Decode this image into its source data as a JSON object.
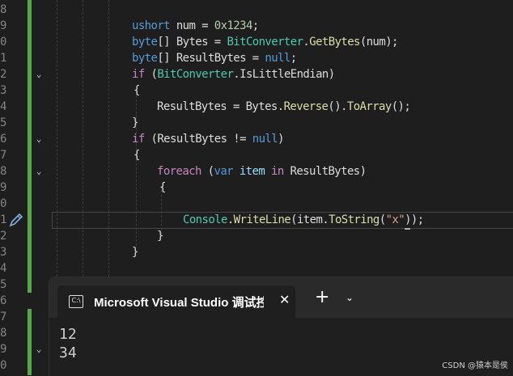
{
  "editor": {
    "line_numbers": [
      "8",
      "9",
      "0",
      "1",
      "2",
      "3",
      "4",
      "5",
      "6",
      "7",
      "8",
      "9",
      "0",
      "1",
      "2",
      "3",
      "4",
      "5",
      "6",
      "7",
      "8",
      "9",
      "0"
    ],
    "code": {
      "l1": {
        "t1": "ushort",
        "t2": " num = ",
        "t3": "0x1234",
        "t4": ";"
      },
      "l2": {
        "t1": "byte",
        "t2": "[] Bytes = ",
        "t3": "BitConverter",
        "t4": ".",
        "t5": "GetBytes",
        "t6": "(num);"
      },
      "l3": {
        "t1": "byte",
        "t2": "[] ResultBytes = ",
        "t3": "null",
        "t4": ";"
      },
      "l4": {
        "t1": "if",
        "t2": " (",
        "t3": "BitConverter",
        "t4": ".",
        "t5": "IsLittleEndian",
        "t6": ")"
      },
      "l5": {
        "t1": "{"
      },
      "l6": {
        "t1": "ResultBytes = Bytes.",
        "t2": "Reverse",
        "t3": "().",
        "t4": "ToArray",
        "t5": "();"
      },
      "l7": {
        "t1": "}"
      },
      "l8": {
        "t1": "if",
        "t2": " (ResultBytes != ",
        "t3": "null",
        "t4": ")"
      },
      "l9": {
        "t1": "{"
      },
      "l10": {
        "t1": "foreach",
        "t2": " (",
        "t3": "var",
        "t4": " ",
        "t5": "item",
        "t6": " ",
        "t7": "in",
        "t8": " ResultBytes)"
      },
      "l11": {
        "t1": "{"
      },
      "l12": {
        "t1": "Console",
        "t2": ".",
        "t3": "WriteLine",
        "t4": "(item.",
        "t5": "ToString",
        "t6": "(",
        "t7": "\"x\"",
        "t8": "));"
      },
      "l13": {
        "t1": "}"
      },
      "l14": {
        "t1": "}"
      }
    }
  },
  "terminal": {
    "tab_title": "Microsoft Visual Studio 调试控制台",
    "tab_icon_text": "C:\\",
    "close_glyph": "✕",
    "new_tab_glyph": "+",
    "dropdown_glyph": "⌄",
    "output": [
      "12",
      "34"
    ]
  },
  "watermark": "CSDN @猿本是侯",
  "icons": {
    "fold": "chevron-down-icon",
    "edit": "pencil-icon"
  }
}
